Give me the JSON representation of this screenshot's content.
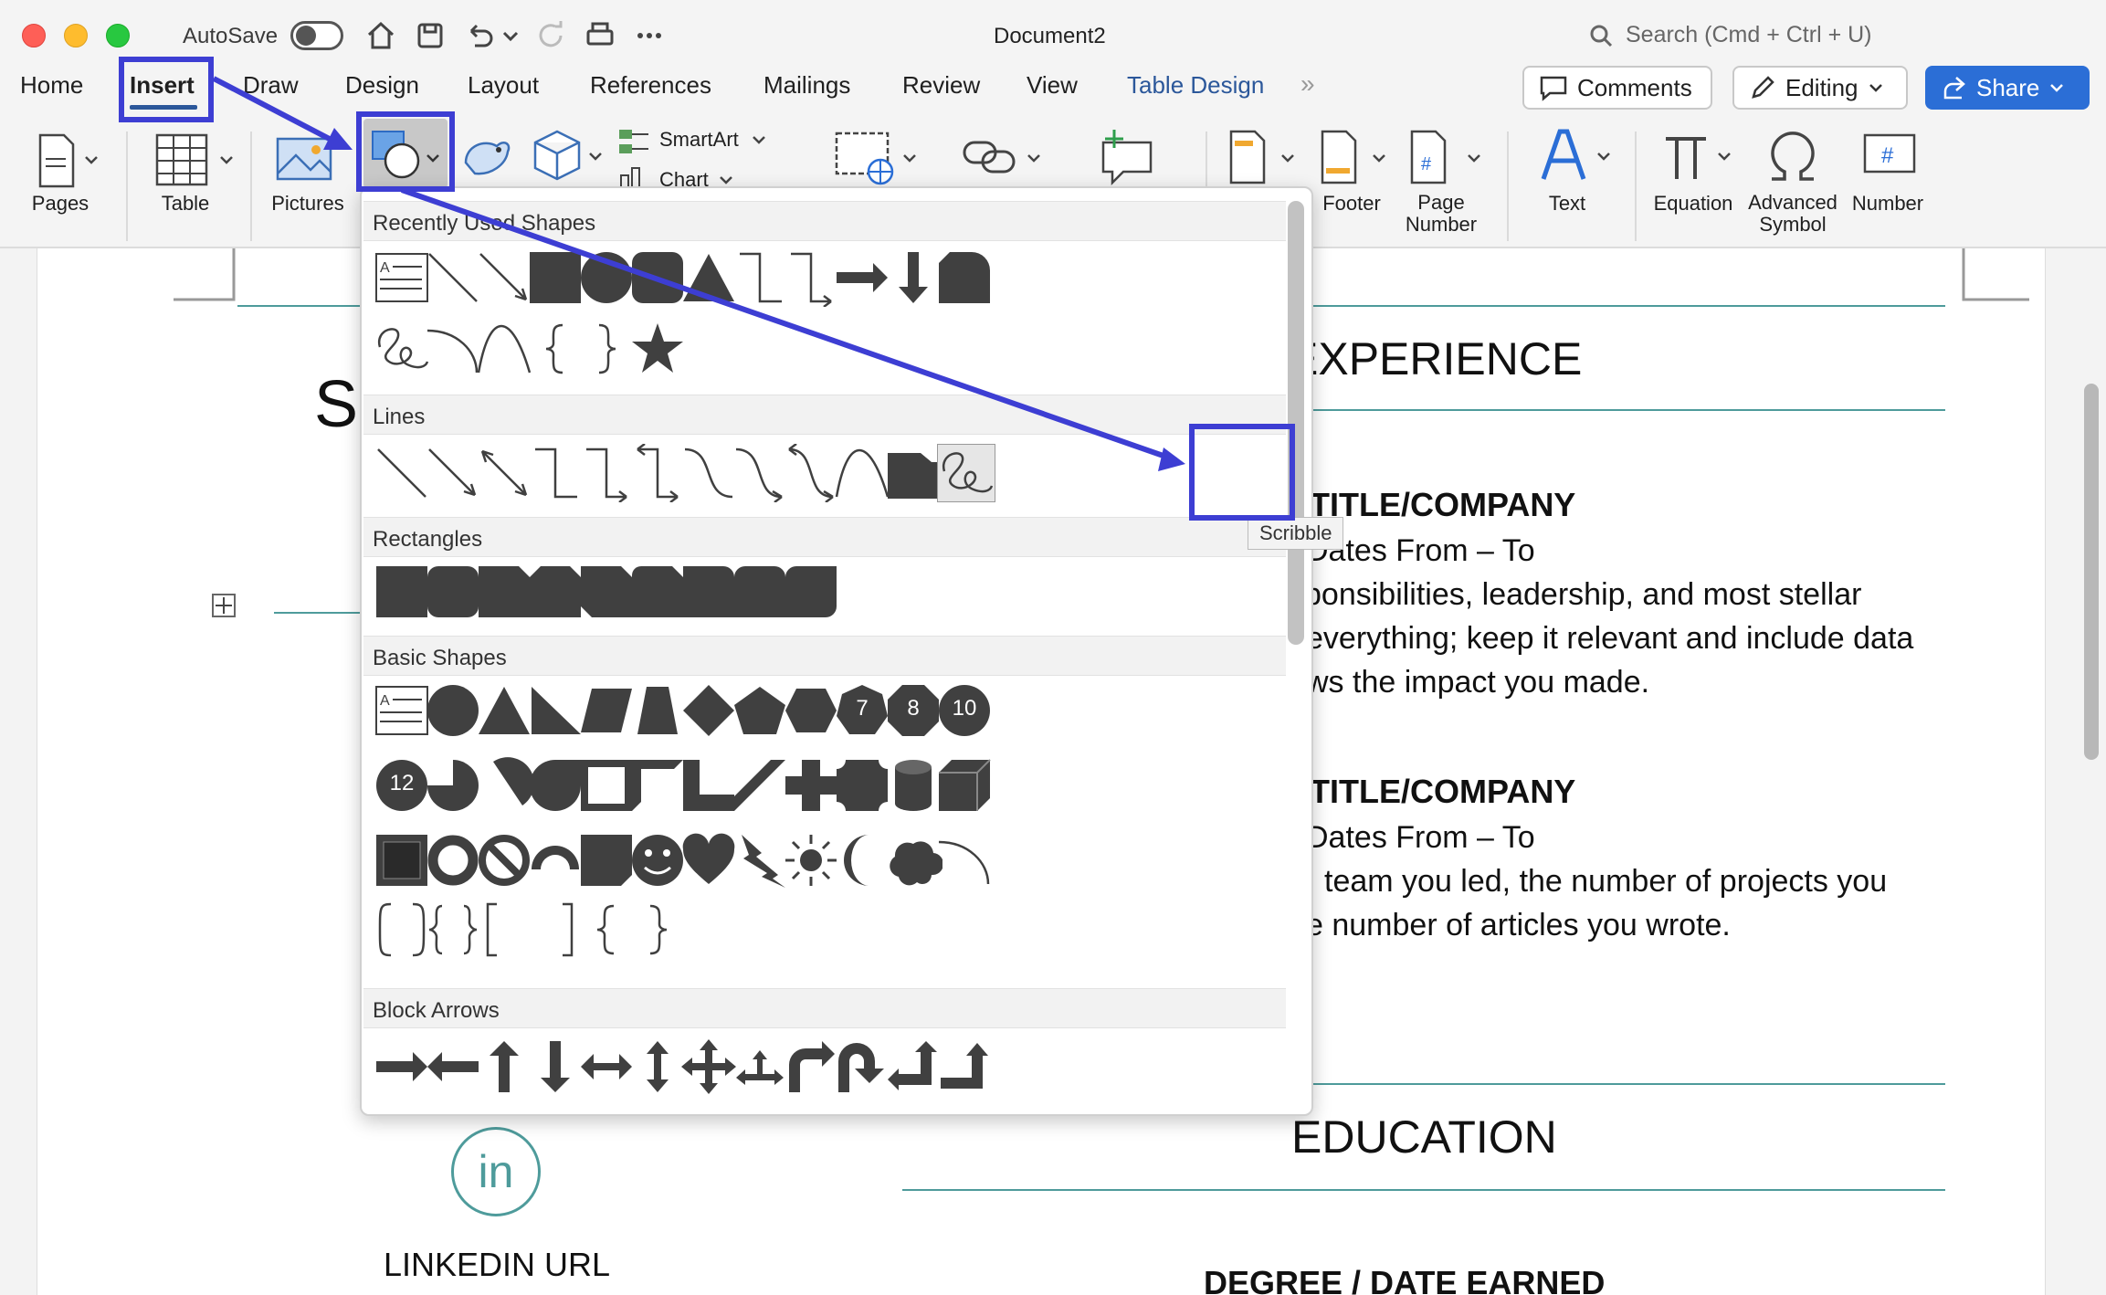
{
  "window": {
    "title": "Document2",
    "autosave_label": "AutoSave",
    "search_placeholder": "Search (Cmd + Ctrl + U)"
  },
  "tabs": [
    {
      "label": "Home"
    },
    {
      "label": "Insert"
    },
    {
      "label": "Draw"
    },
    {
      "label": "Design"
    },
    {
      "label": "Layout"
    },
    {
      "label": "References"
    },
    {
      "label": "Mailings"
    },
    {
      "label": "Review"
    },
    {
      "label": "View"
    },
    {
      "label": "Table Design"
    }
  ],
  "tabs_more": "»",
  "top_buttons": {
    "comments": "Comments",
    "editing": "Editing",
    "share": "Share"
  },
  "ribbon": {
    "pages": "Pages",
    "table": "Table",
    "pictures": "Pictures",
    "smartart": "SmartArt",
    "chart": "Chart",
    "footer": "Footer",
    "page_number_1": "Page",
    "page_number_2": "Number",
    "text": "Text",
    "equation": "Equation",
    "advanced_1": "Advanced",
    "advanced_2": "Symbol",
    "number": "Number"
  },
  "shape_panel": {
    "sections": {
      "recent": "Recently Used Shapes",
      "lines": "Lines",
      "rectangles": "Rectangles",
      "basic": "Basic Shapes",
      "block_arrows": "Block Arrows"
    },
    "tooltip": "Scribble",
    "badges": [
      "7",
      "8",
      "10",
      "12"
    ]
  },
  "document": {
    "partial_heading": "S",
    "experience": "EXPERIENCE",
    "job1_title": "TITLE/COMPANY",
    "job1_dates": "Dates From – To",
    "job1_line1": "ponsibilities, leadership, and most stellar",
    "job1_line2": "everything; keep it relevant and include data",
    "job1_line3": "ws the impact you made.",
    "job2_title": "TITLE/COMPANY",
    "job2_dates": "Dates From – To",
    "job2_line1": "team you led, the number of projects you",
    "job2_line2": "e number of articles you wrote.",
    "education": "EDUCATION",
    "degree": "DEGREE / DATE EARNED",
    "linkedin_icon": "in",
    "linkedin": "LINKEDIN URL"
  },
  "colors": {
    "accent": "#2b579a",
    "annotation": "#3d3ed3",
    "teal": "#4e9b9b",
    "shape_fill": "#404040"
  }
}
